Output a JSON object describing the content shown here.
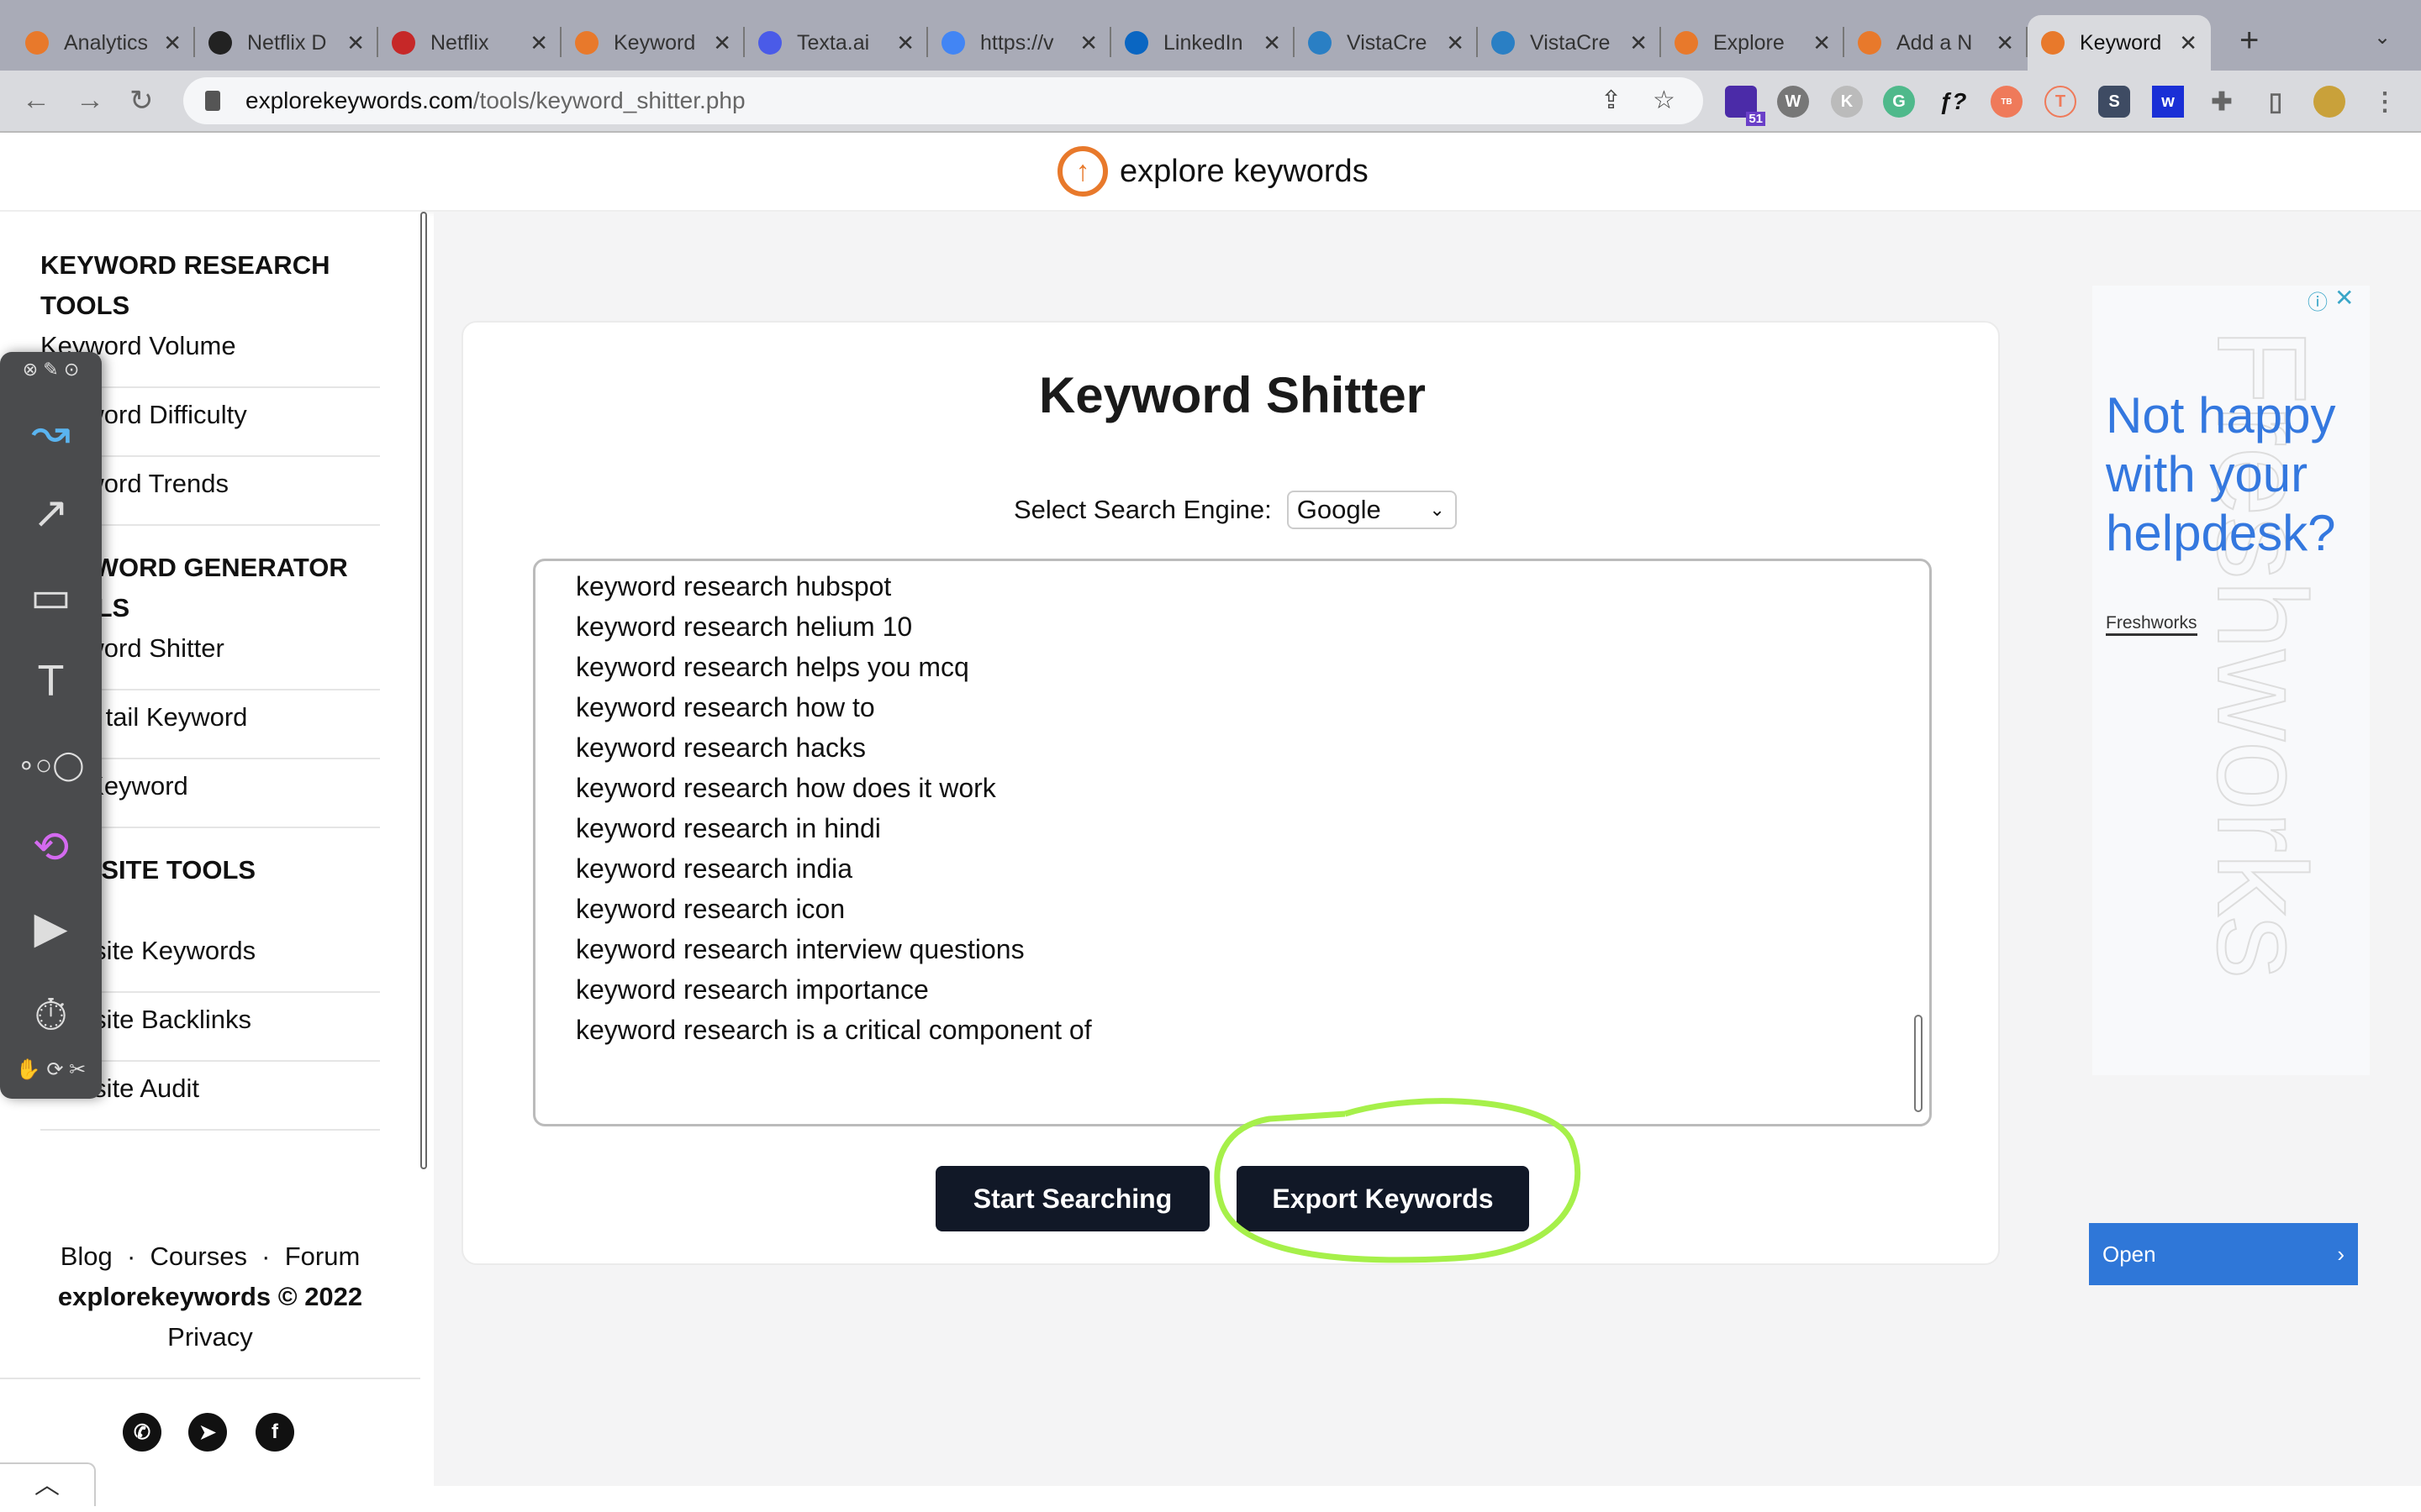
{
  "browser": {
    "tabs": [
      {
        "title": "Analytics",
        "icon": "analytics-icon",
        "color": "#e8792b"
      },
      {
        "title": "Netflix D",
        "icon": "globe-icon",
        "color": "#222"
      },
      {
        "title": "Netflix",
        "icon": "netflix-icon",
        "color": "#c62828"
      },
      {
        "title": "Keyword",
        "icon": "explorekeywords-icon",
        "color": "#e8792b"
      },
      {
        "title": "Texta.ai",
        "icon": "texta-icon",
        "color": "#4a5be8"
      },
      {
        "title": "https://v",
        "icon": "google-icon",
        "color": "#4285f4"
      },
      {
        "title": "LinkedIn",
        "icon": "linkedin-icon",
        "color": "#0a66c2"
      },
      {
        "title": "VistaCre",
        "icon": "vistacreate-icon",
        "color": "#2a7fc4"
      },
      {
        "title": "VistaCre",
        "icon": "vistacreate-icon",
        "color": "#2a7fc4"
      },
      {
        "title": "Explore",
        "icon": "explorekeywords-icon",
        "color": "#e8792b"
      },
      {
        "title": "Add a N",
        "icon": "explorekeywords-icon",
        "color": "#e8792b"
      },
      {
        "title": "Keyword",
        "icon": "explorekeywords-icon",
        "color": "#e8792b",
        "active": true
      }
    ],
    "url_host": "explorekeywords.com",
    "url_path": "/tools/keyword_shitter.php",
    "extension_badge": "51"
  },
  "site": {
    "logo_text": "explore keywords",
    "accent": "#e8792b"
  },
  "sidebar": {
    "sections": [
      {
        "heading": "KEYWORD RESEARCH TOOLS",
        "items": [
          "Keyword Volume",
          "Keyword Difficulty",
          "Keyword Trends"
        ]
      },
      {
        "heading": "KEYWORD GENERATOR TOOLS",
        "items": [
          "Keyword Shitter",
          "Long tail Keyword",
          "LSI Keyword"
        ]
      },
      {
        "heading": "WEBSITE TOOLS",
        "items": [
          "Website Keywords",
          "Website Backlinks",
          "Website Audit"
        ]
      }
    ],
    "footer_links": [
      "Blog",
      "Courses",
      "Forum"
    ],
    "copyright": "explorekeywords © 2022",
    "privacy": "Privacy"
  },
  "main": {
    "title": "Keyword Shitter",
    "engine_label": "Select Search Engine:",
    "engine_value": "Google",
    "results": [
      "keyword research hubspot",
      "keyword research helium 10",
      "keyword research helps you mcq",
      "keyword research how to",
      "keyword research hacks",
      "keyword research how does it work",
      "keyword research in hindi",
      "keyword research india",
      "keyword research icon",
      "keyword research interview questions",
      "keyword research importance",
      "keyword research is a critical component of"
    ],
    "start_button": "Start Searching",
    "export_button": "Export Keywords",
    "highlight_color": "#a6f04a"
  },
  "ad": {
    "headline": "Not happy with your helpdesk?",
    "brand": "Freshworks",
    "open_button": "Open"
  }
}
